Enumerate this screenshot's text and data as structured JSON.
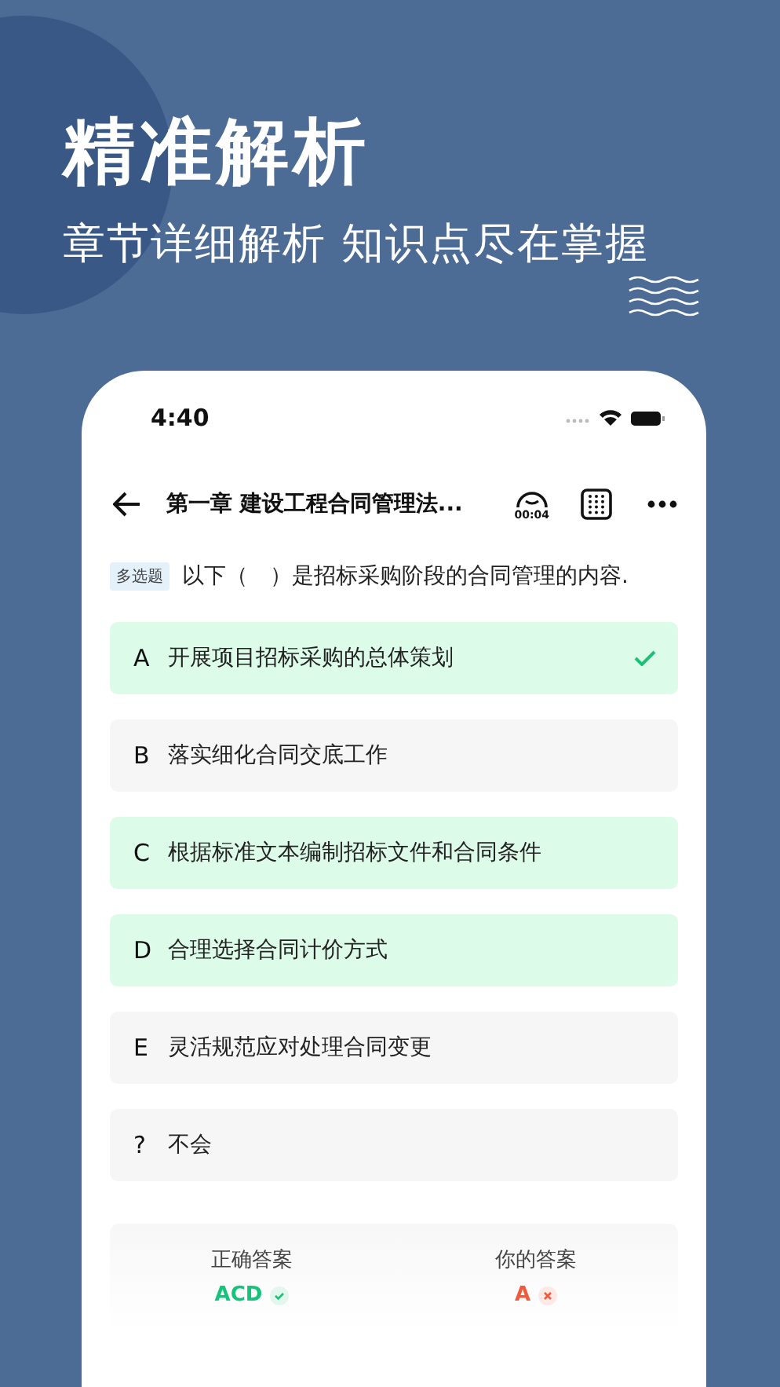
{
  "banner": {
    "title": "精准解析",
    "subtitle": "章节详细解析 知识点尽在掌握"
  },
  "status_bar": {
    "time": "4:40"
  },
  "nav": {
    "title": "第一章 建设工程合同管理法...",
    "timer": "00:04"
  },
  "question": {
    "tag": "多选题",
    "text": "以下（　）是招标采购阶段的合同管理的内容."
  },
  "options": [
    {
      "letter": "A",
      "text": "开展项目招标采购的总体策划",
      "correct": true,
      "selected": true
    },
    {
      "letter": "B",
      "text": "落实细化合同交底工作",
      "correct": false,
      "selected": false
    },
    {
      "letter": "C",
      "text": "根据标准文本编制招标文件和合同条件",
      "correct": true,
      "selected": false
    },
    {
      "letter": "D",
      "text": "合理选择合同计价方式",
      "correct": true,
      "selected": false
    },
    {
      "letter": "E",
      "text": "灵活规范应对处理合同变更",
      "correct": false,
      "selected": false
    },
    {
      "letter": "?",
      "text": "不会",
      "correct": false,
      "selected": false
    }
  ],
  "answers": [
    {
      "label": "正确答案",
      "value": "ACD",
      "kind": "correct"
    },
    {
      "label": "你的答案",
      "value": "A",
      "kind": "wrong"
    }
  ]
}
